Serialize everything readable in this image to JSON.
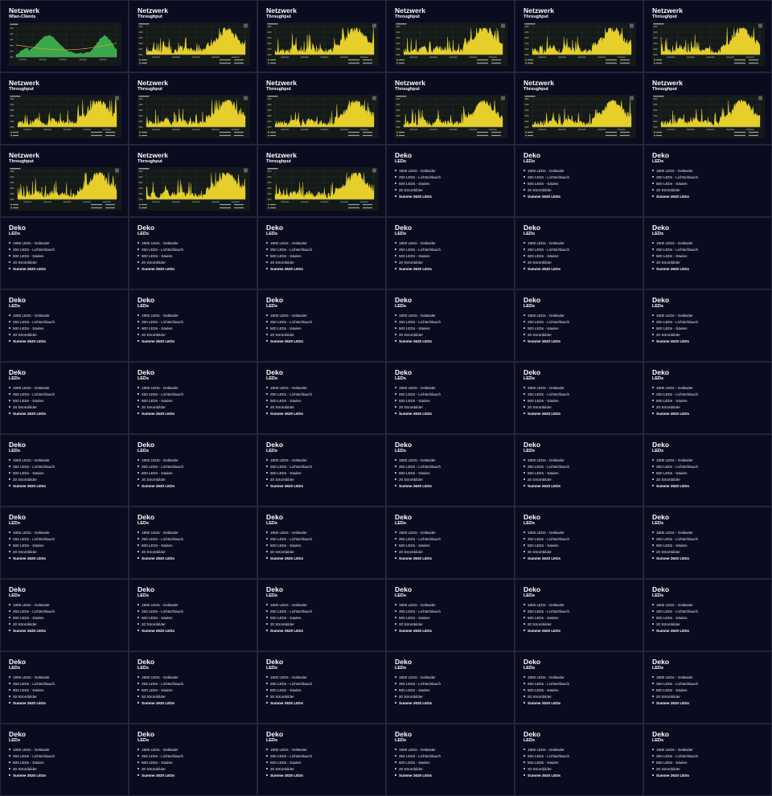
{
  "tiles": [
    {
      "kind": "chart-clients",
      "title": "Netzwerk",
      "subtitle": "Wlan-Clients"
    },
    {
      "kind": "chart-throughput",
      "title": "Netzwerk",
      "subtitle": "Throughput"
    },
    {
      "kind": "chart-throughput",
      "title": "Netzwerk",
      "subtitle": "Throughput"
    },
    {
      "kind": "chart-throughput",
      "title": "Netzwerk",
      "subtitle": "Throughput"
    },
    {
      "kind": "chart-throughput",
      "title": "Netzwerk",
      "subtitle": "Throughput"
    },
    {
      "kind": "chart-throughput",
      "title": "Netzwerk",
      "subtitle": "Throughput"
    },
    {
      "kind": "chart-throughput",
      "title": "Netzwerk",
      "subtitle": "Throughput"
    },
    {
      "kind": "chart-throughput",
      "title": "Netzwerk",
      "subtitle": "Throughput"
    },
    {
      "kind": "chart-throughput",
      "title": "Netzwerk",
      "subtitle": "Throughput"
    },
    {
      "kind": "chart-throughput",
      "title": "Netzwerk",
      "subtitle": "Throughput"
    },
    {
      "kind": "chart-throughput",
      "title": "Netzwerk",
      "subtitle": "Throughput"
    },
    {
      "kind": "chart-throughput",
      "title": "Netzwerk",
      "subtitle": "Throughput"
    },
    {
      "kind": "chart-throughput",
      "title": "Netzwerk",
      "subtitle": "Throughput"
    },
    {
      "kind": "chart-throughput",
      "title": "Netzwerk",
      "subtitle": "Throughput"
    },
    {
      "kind": "chart-throughput",
      "title": "Netzwerk",
      "subtitle": "Throughput"
    }
  ],
  "deko": {
    "title": "Deko",
    "subtitle": "LEDs",
    "items": [
      "1900 LEDs - Geländer",
      "250 LEDs - Lichtschlauch",
      "500 LEDs - Säulen",
      "20 Strombilder"
    ],
    "sum": "Summe 2620 LEDs"
  },
  "deko_tile_count": 51,
  "colors": {
    "tile_bg": "#0b0b20",
    "page_bg": "#23253a",
    "chart_bg": "#141a18",
    "throughput_fill": "#e6cf2a",
    "clients_fill": "#3aa84a",
    "clients_trend": "#e0a03a"
  }
}
